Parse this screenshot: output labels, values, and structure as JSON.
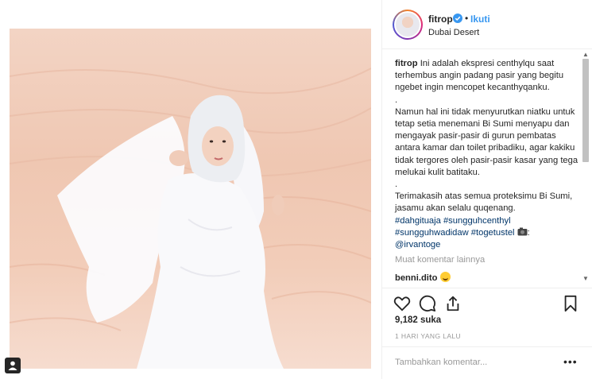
{
  "post": {
    "username": "fitrop",
    "dot": "•",
    "follow_label": "Ikuti",
    "location": "Dubai Desert",
    "caption": {
      "line1": "Ini adalah ekspresi centhylqu saat terhembus angin padang pasir yang begitu ngebet ingin mencopet kecanthyqanku.",
      "dot1": ".",
      "para2": "Namun hal ini tidak menyurutkan niatku untuk tetap setia menemani Bi Sumi menyapu dan mengayak pasir-pasir di gurun pembatas antara kamar dan toilet pribadiku, agar kakiku tidak tergores oleh pasir-pasir kasar yang tega melukai kulit batitaku.",
      "dot2": ".",
      "para3": "Terimakasih atas semua proteksimu Bi Sumi, jasamu akan selalu quqenang.",
      "tags_line1": "#dahgituaja #sungguhcenthyl",
      "tags_line2a": "#sungguhwadidaw #togetustel",
      "tags_line2_suffix": ":",
      "mention": "@irvantoge"
    },
    "more_comments": "Muat komentar lainnya",
    "comment": {
      "user": "benni.dito"
    },
    "likes": "9,182 suka",
    "time": "1 HARI YANG LALU",
    "add_comment_placeholder": "Tambahkan komentar...",
    "more_options": "•••"
  },
  "icons": {
    "verified": "verified-badge-icon",
    "like": "heart-icon",
    "comment": "comment-bubble-icon",
    "share": "share-icon",
    "save": "bookmark-icon",
    "tag": "user-tag-icon",
    "camera": "camera-emoji-icon",
    "laugh": "laughing-emoji-icon"
  },
  "colors": {
    "link": "#3897f0",
    "hashtag": "#003569",
    "muted": "#999999",
    "text": "#262626"
  }
}
